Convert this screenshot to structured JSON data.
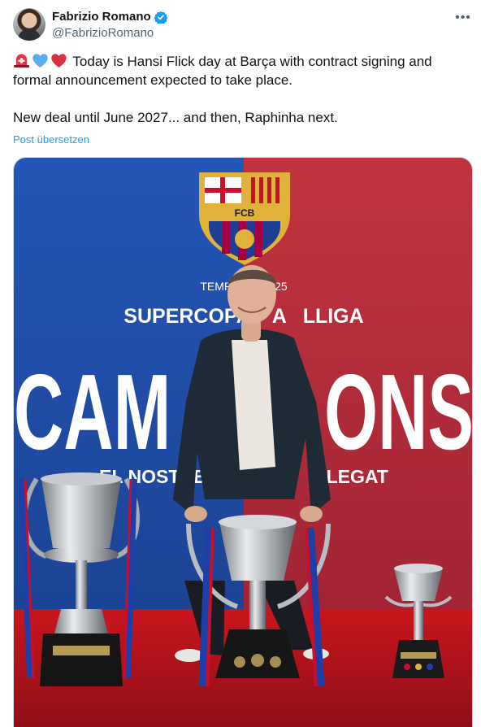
{
  "author": {
    "display_name": "Fabrizio Romano",
    "handle": "@FabrizioRomano"
  },
  "tweet": {
    "line1": "Today is Hansi Flick day at Barça with contract signing and formal announcement expected to take place.",
    "line2": "New deal until June 2027... and then, Raphinha next.",
    "emojis": [
      "siren-icon",
      "blue-heart-icon",
      "red-heart-icon"
    ]
  },
  "translate_label": "Post übersetzen",
  "photo": {
    "crest_text": "FCB",
    "season_text": "TEMPORA   4/25",
    "supercopa_text": "SUPERCOPA    A   LLIGA",
    "big_text": "CAM        ONS",
    "slogan_text": "EL NOSTRE                     LLEGAT"
  },
  "colors": {
    "accent": "#1d9bf0",
    "barca_blue": "#1c4ea8",
    "barca_red": "#b0243a",
    "carpet_red": "#c4161c"
  }
}
